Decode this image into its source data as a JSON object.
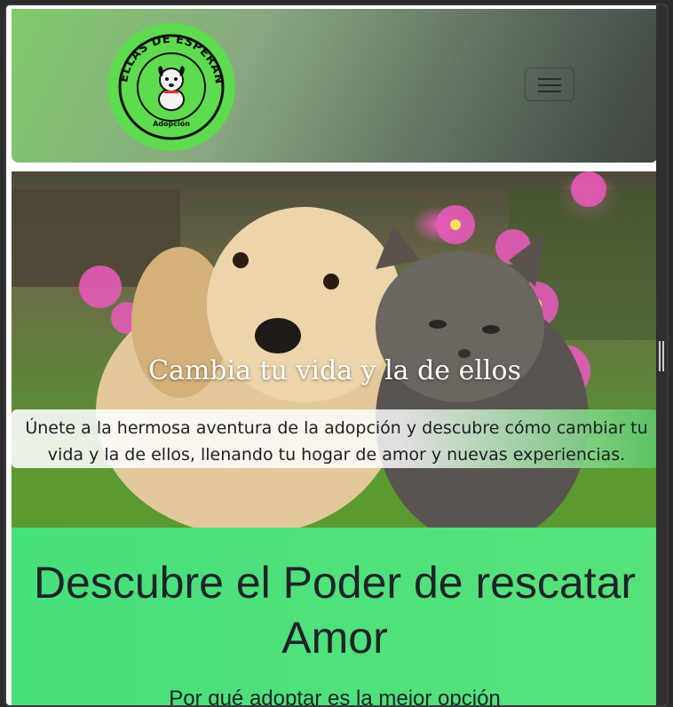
{
  "header": {
    "logo_text": "HUELLAS DE ESPERANZA",
    "logo_subtext": "Adopción",
    "menu_toggle_icon": "hamburger-icon"
  },
  "hero": {
    "title": "Cambia tu vida y la de ellos",
    "description": "Únete a la hermosa aventura de la adopción y descubre cómo cambiar tu vida y la de ellos, llenando tu hogar de amor y nuevas experiencias."
  },
  "section": {
    "heading": "Descubre el Poder de rescatar Amor",
    "subheading": "Por qué adoptar es la mejor opción"
  },
  "colors": {
    "logo_green": "#5fdb4f",
    "section_green": "#4ee07b",
    "text_dark": "#1f2328"
  }
}
